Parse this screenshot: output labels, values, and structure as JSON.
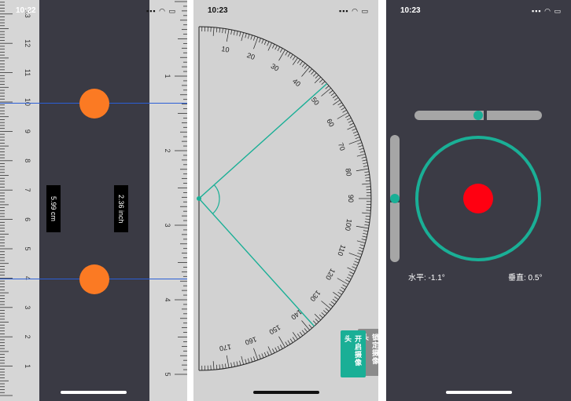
{
  "ruler_screen": {
    "time": "10:22",
    "left_ticks": [
      "1",
      "2",
      "3",
      "4",
      "5",
      "6",
      "7",
      "8",
      "9",
      "10",
      "11",
      "12",
      "13"
    ],
    "right_ticks": [
      "1",
      "2",
      "3",
      "4",
      "5"
    ],
    "cm_readout": "5.99 cm",
    "inch_readout": "2.36 inch"
  },
  "protractor_screen": {
    "time": "10:23",
    "degree_labels": [
      "10",
      "20",
      "30",
      "40",
      "50",
      "60",
      "70",
      "80",
      "90",
      "100",
      "110",
      "120",
      "130",
      "140",
      "150",
      "160",
      "170"
    ],
    "ray_angles_deg": [
      48,
      138
    ],
    "buttons": {
      "lock_camera": "锁定摄像头",
      "open_camera": "开启摄像头"
    }
  },
  "level_screen": {
    "time": "10:23",
    "horizontal_label": "水平: -1.1°",
    "vertical_label": "垂直: 0.5°"
  },
  "colors": {
    "accent_teal": "#1aaf96",
    "handle_orange": "#fb7a23",
    "bubble_red": "#ff0011",
    "measure_line_blue": "#2b5fd6",
    "lock_button_gray": "#8b8b8b"
  }
}
